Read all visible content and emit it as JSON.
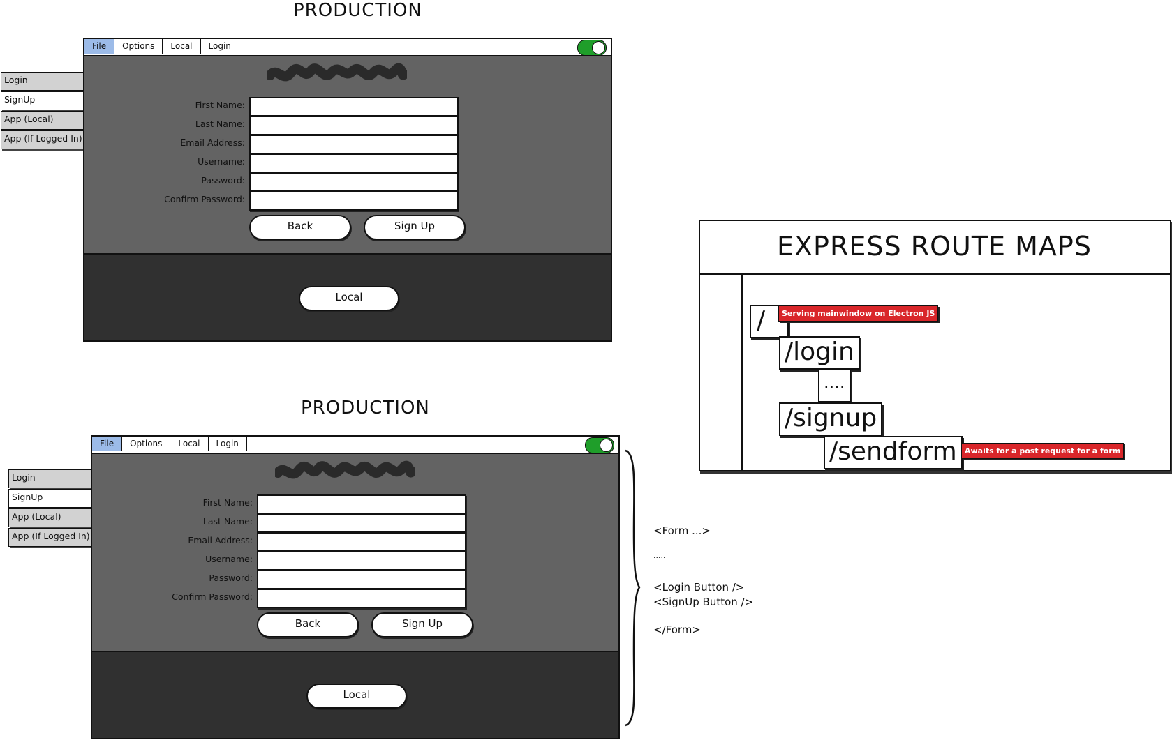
{
  "headings": {
    "top": "PRODUCTION",
    "bottom": "PRODUCTION"
  },
  "menu": [
    "File",
    "Options",
    "Local",
    "Login"
  ],
  "side_tabs": [
    "Login",
    "SignUp",
    "App (Local)",
    "App (If Logged In)"
  ],
  "form": {
    "labels": [
      "First Name:",
      "Last Name:",
      "Email Address:",
      "Username:",
      "Password:",
      "Confirm Password:"
    ],
    "back_label": "Back",
    "signup_label": "Sign Up",
    "local_label": "Local"
  },
  "route_map": {
    "title": "EXPRESS ROUTE MAPS",
    "root": "/",
    "root_note": "Serving mainwindow on Electron JS",
    "login": "/login",
    "ellipsis": "....",
    "signup": "/signup",
    "sendform": "/sendform",
    "sendform_note": "Awaits for a post request for a form"
  },
  "code_note": [
    "<Form ...>",
    ".....",
    "<Login Button />",
    "<SignUp Button />",
    "</Form>"
  ],
  "colors": {
    "frame_bg": "#636363",
    "bottom_panel": "#303030",
    "active_menu": "#9cbbe8",
    "toggle_on": "#1f9e2a",
    "tag_red": "#d9262a"
  }
}
